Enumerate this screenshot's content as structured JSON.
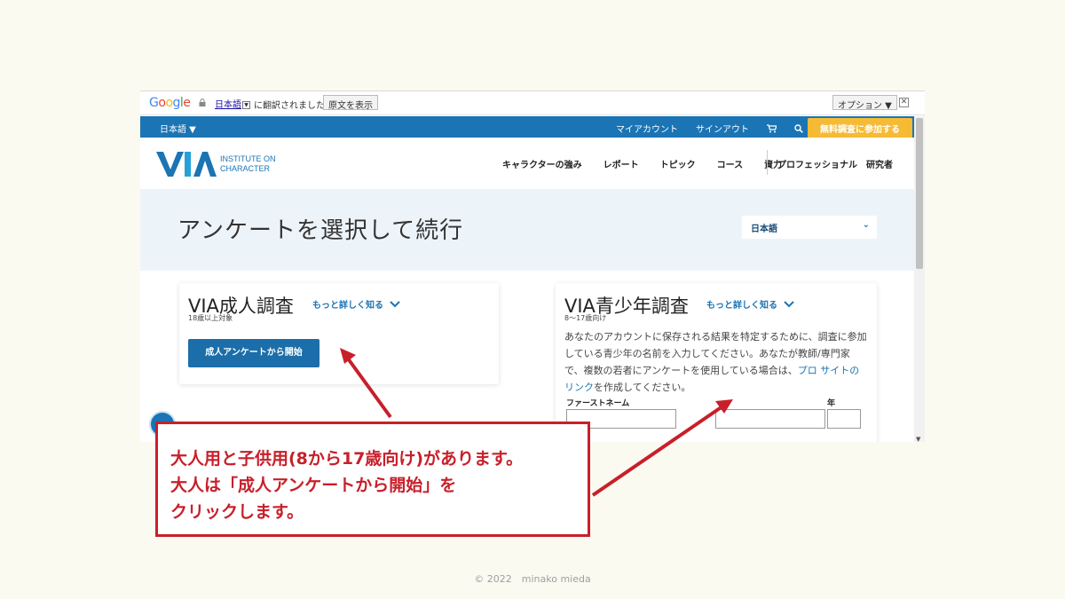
{
  "google_bar": {
    "logo": "Google",
    "language": "日本語",
    "translated_text": "に翻訳されました",
    "show_original": "原文を表示",
    "options": "オプション ▼",
    "close": "✕"
  },
  "topbar": {
    "language": "日本語 ▼",
    "my_account": "マイアカウント",
    "sign_out": "サインアウト",
    "cart_icon": "cart-icon",
    "search_icon": "search-icon",
    "join_button": "無料調査に参加する"
  },
  "logo": {
    "line1": "INSTITUTE ON",
    "line2": "CHARACTER"
  },
  "nav": {
    "items": [
      "キャラクターの強み",
      "レポート",
      "トピック",
      "コース",
      "資力"
    ],
    "professional": "プロフェッショナル",
    "research": "研究者"
  },
  "header": {
    "title": "アンケートを選択して続行",
    "language_select": "日本語"
  },
  "adult_card": {
    "title": "VIA成人調査",
    "more": "もっと詳しく知る",
    "subtitle": "18歳以上対象",
    "start_button": "成人アンケートから開始"
  },
  "youth_card": {
    "title": "VIA青少年調査",
    "more": "もっと詳しく知る",
    "subtitle": "8～17歳向け",
    "description_1": "あなたのアカウントに保存される結果を特定するために、調査に参加している青少年の名前を入力してください。あなたが教師/専門家で、複数の若者にアンケートを使用している場合は、",
    "description_link": "プロ サイトのリンク",
    "description_2": "を作成してください。",
    "first_name_label": "ファーストネーム",
    "age_label": "年"
  },
  "annotation": {
    "line1": "大人用と子供用(8から17歳向け)があります。",
    "line2": "大人は「成人アンケートから開始」を",
    "line3": "クリックします。"
  },
  "colors": {
    "accent": "#1b74b4",
    "join": "#f6bb35",
    "annotation": "#c81f2a"
  },
  "footer": "© 2022　minako mieda"
}
